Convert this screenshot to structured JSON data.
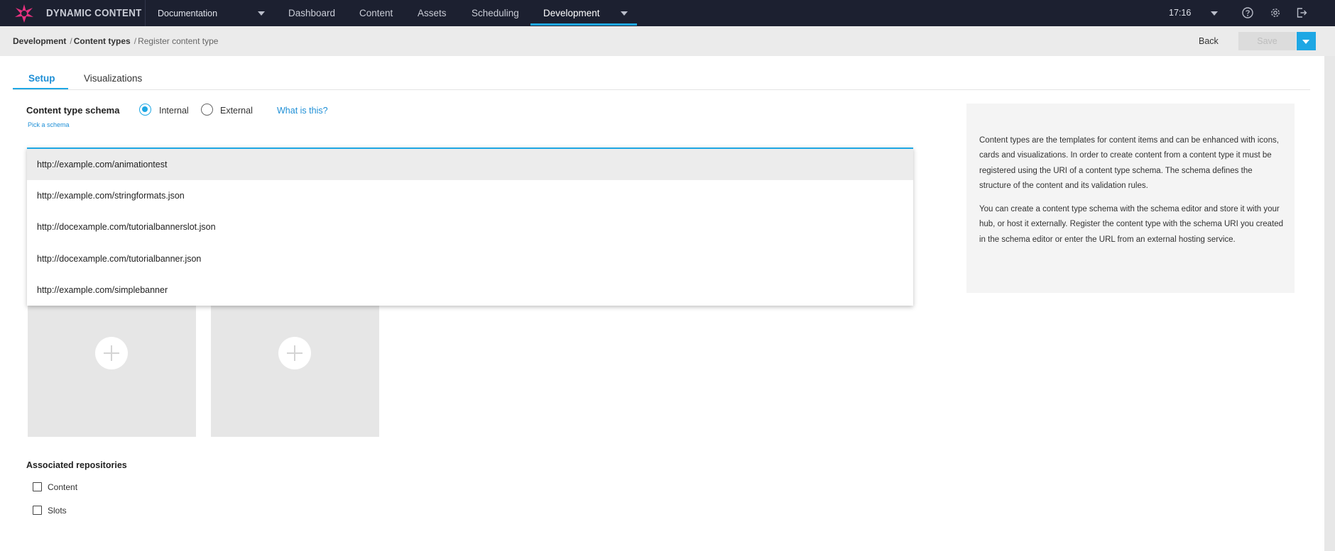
{
  "app": {
    "brand": "DYNAMIC CONTENT",
    "hub": "Documentation",
    "nav": [
      "Dashboard",
      "Content",
      "Assets",
      "Scheduling",
      "Development"
    ],
    "active_nav": "Development",
    "time": "17:16",
    "accent_color": "#1ea7e4",
    "logo_color": "#e8317f"
  },
  "breadcrumb": {
    "items": [
      "Development",
      "Content types",
      "Register content type"
    ],
    "separator": "/"
  },
  "actions": {
    "back_label": "Back",
    "save_label": "Save",
    "save_enabled": false
  },
  "tabs": [
    {
      "label": "Setup",
      "active": true
    },
    {
      "label": "Visualizations",
      "active": false
    }
  ],
  "schema": {
    "label": "Content type schema",
    "pick_label": "Pick a schema",
    "options": [
      {
        "label": "Internal",
        "selected": true
      },
      {
        "label": "External",
        "selected": false
      }
    ],
    "help_link": "What is this?",
    "dropdown_items": [
      "http://example.com/animationtest",
      "http://example.com/stringformats.json",
      "http://docexample.com/tutorialbannerslot.json",
      "http://docexample.com/tutorialbanner.json",
      "http://example.com/simplebanner"
    ],
    "highlighted_index": 0
  },
  "info": {
    "paragraph1": "Content types are the templates for content items and can be enhanced with icons, cards and visualizations. In order to create content from a content type it must be registered using the URI of a content type schema. The schema defines the structure of the content and its validation rules.",
    "paragraph2": "You can create a content type schema with the schema editor and store it with your hub, or host it externally. Register the content type with the schema URI you created in the schema editor or enter the URL from an external hosting service."
  },
  "repositories": {
    "label": "Associated repositories",
    "items": [
      {
        "label": "Content",
        "checked": false
      },
      {
        "label": "Slots",
        "checked": false
      }
    ]
  },
  "icons": [
    "logo-icon",
    "chevron-down-icon",
    "help-icon",
    "gear-icon",
    "sign-out-icon",
    "add-icon"
  ]
}
